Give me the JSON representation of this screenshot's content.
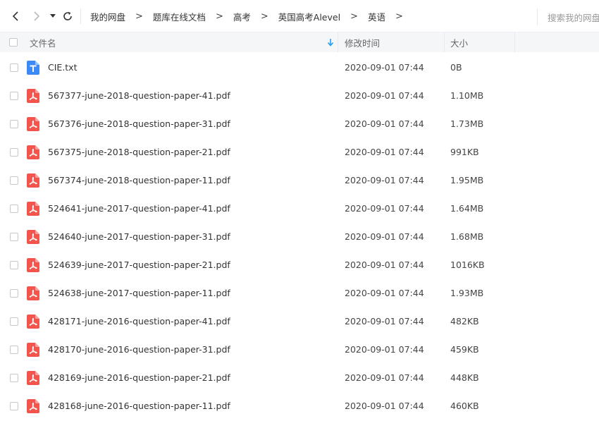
{
  "breadcrumb": [
    "我的网盘",
    "题库在线文档",
    "高考",
    "英国高考Alevel",
    "英语"
  ],
  "search": {
    "placeholder": "搜索我的网盘"
  },
  "columns": {
    "name": "文件名",
    "date": "修改时间",
    "size": "大小"
  },
  "colors": {
    "accent": "#1a9bf0",
    "pdf": "#f2544e",
    "txt": "#3d8af7"
  },
  "files": [
    {
      "name": "CIE.txt",
      "date": "2020-09-01 07:44",
      "size": "0B",
      "icon": "txt-file-icon"
    },
    {
      "name": "567377-june-2018-question-paper-41.pdf",
      "date": "2020-09-01 07:44",
      "size": "1.10MB",
      "icon": "pdf-file-icon"
    },
    {
      "name": "567376-june-2018-question-paper-31.pdf",
      "date": "2020-09-01 07:44",
      "size": "1.73MB",
      "icon": "pdf-file-icon"
    },
    {
      "name": "567375-june-2018-question-paper-21.pdf",
      "date": "2020-09-01 07:44",
      "size": "991KB",
      "icon": "pdf-file-icon"
    },
    {
      "name": "567374-june-2018-question-paper-11.pdf",
      "date": "2020-09-01 07:44",
      "size": "1.95MB",
      "icon": "pdf-file-icon"
    },
    {
      "name": "524641-june-2017-question-paper-41.pdf",
      "date": "2020-09-01 07:44",
      "size": "1.64MB",
      "icon": "pdf-file-icon"
    },
    {
      "name": "524640-june-2017-question-paper-31.pdf",
      "date": "2020-09-01 07:44",
      "size": "1.68MB",
      "icon": "pdf-file-icon"
    },
    {
      "name": "524639-june-2017-question-paper-21.pdf",
      "date": "2020-09-01 07:44",
      "size": "1016KB",
      "icon": "pdf-file-icon"
    },
    {
      "name": "524638-june-2017-question-paper-11.pdf",
      "date": "2020-09-01 07:44",
      "size": "1.93MB",
      "icon": "pdf-file-icon"
    },
    {
      "name": "428171-june-2016-question-paper-41.pdf",
      "date": "2020-09-01 07:44",
      "size": "482KB",
      "icon": "pdf-file-icon"
    },
    {
      "name": "428170-june-2016-question-paper-31.pdf",
      "date": "2020-09-01 07:44",
      "size": "459KB",
      "icon": "pdf-file-icon"
    },
    {
      "name": "428169-june-2016-question-paper-21.pdf",
      "date": "2020-09-01 07:44",
      "size": "448KB",
      "icon": "pdf-file-icon"
    },
    {
      "name": "428168-june-2016-question-paper-11.pdf",
      "date": "2020-09-01 07:44",
      "size": "460KB",
      "icon": "pdf-file-icon"
    }
  ]
}
